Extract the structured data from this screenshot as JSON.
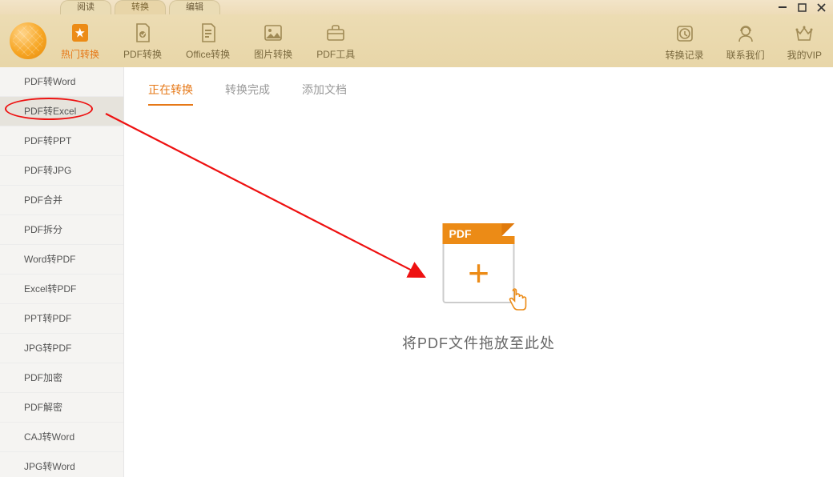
{
  "titlebar": {
    "tabs": [
      {
        "label": "阅读"
      },
      {
        "label": "转换"
      },
      {
        "label": "编辑"
      }
    ]
  },
  "toolbar": {
    "left": [
      {
        "label": "热门转换",
        "icon": "hot-icon"
      },
      {
        "label": "PDF转换",
        "icon": "pdf-icon"
      },
      {
        "label": "Office转换",
        "icon": "office-icon"
      },
      {
        "label": "图片转换",
        "icon": "image-icon"
      },
      {
        "label": "PDF工具",
        "icon": "toolbox-icon"
      }
    ],
    "right": [
      {
        "label": "转换记录",
        "icon": "history-icon"
      },
      {
        "label": "联系我们",
        "icon": "support-icon"
      },
      {
        "label": "我的VIP",
        "icon": "vip-icon"
      }
    ]
  },
  "sidebar": {
    "items": [
      {
        "label": "PDF转Word"
      },
      {
        "label": "PDF转Excel"
      },
      {
        "label": "PDF转PPT"
      },
      {
        "label": "PDF转JPG"
      },
      {
        "label": "PDF合并"
      },
      {
        "label": "PDF拆分"
      },
      {
        "label": "Word转PDF"
      },
      {
        "label": "Excel转PDF"
      },
      {
        "label": "PPT转PDF"
      },
      {
        "label": "JPG转PDF"
      },
      {
        "label": "PDF加密"
      },
      {
        "label": "PDF解密"
      },
      {
        "label": "CAJ转Word"
      },
      {
        "label": "JPG转Word"
      }
    ],
    "selected_index": 1
  },
  "main": {
    "subtabs": [
      {
        "label": "正在转换"
      },
      {
        "label": "转换完成"
      },
      {
        "label": "添加文档"
      }
    ],
    "active_subtab": 0,
    "dropzone": {
      "badge": "PDF",
      "text": "将PDF文件拖放至此处"
    }
  },
  "annotation": {
    "highlighted_sidebar_item": "PDF转Excel",
    "arrow_from": "sidebar",
    "arrow_to": "dropzone"
  },
  "colors": {
    "accent": "#e67817",
    "toolbar_bg": "#e9d8ab",
    "annotation_red": "#e11"
  }
}
